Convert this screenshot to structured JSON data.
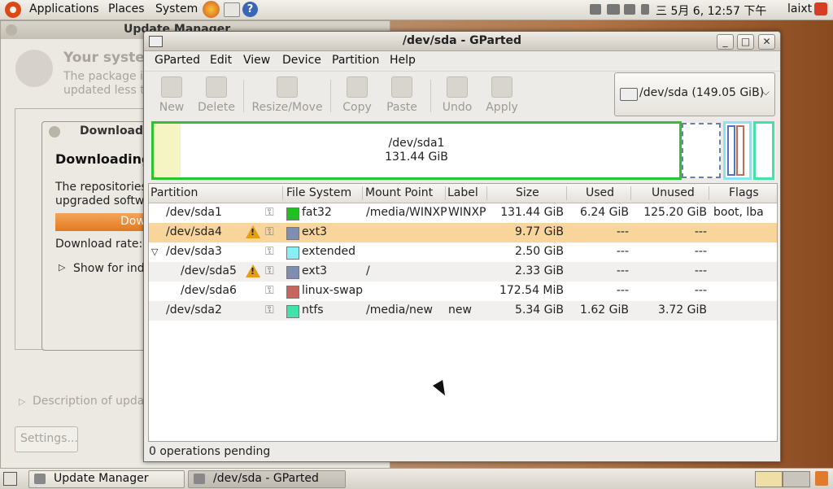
{
  "top_panel": {
    "applications": "Applications",
    "places": "Places",
    "system": "System",
    "clock": "三  5月   6, 12:57 下午",
    "user": "laixt"
  },
  "update_manager": {
    "title": "Update Manager",
    "heading": "Your syster",
    "subtext_1": "The package in",
    "subtext_2": "updated less th",
    "dialog_title": "Downloadi",
    "dialog_heading": "Downloading",
    "dialog_text_1": "The repositories",
    "dialog_text_2": "upgraded softwa",
    "dialog_button": "Dow",
    "download_rate": "Download rate: u",
    "show_for": "Show for indi",
    "description": "Description of update",
    "settings": "Settings..."
  },
  "gparted": {
    "title": "/dev/sda - GParted",
    "menu": {
      "gparted": "GParted",
      "edit": "Edit",
      "view": "View",
      "device": "Device",
      "partition": "Partition",
      "help": "Help"
    },
    "toolbar": {
      "new": "New",
      "delete": "Delete",
      "resize": "Resize/Move",
      "copy": "Copy",
      "paste": "Paste",
      "undo": "Undo",
      "apply": "Apply"
    },
    "device_selector": "/dev/sda  (149.05 GiB)",
    "map_sda1_name": "/dev/sda1",
    "map_sda1_size": "131.44 GiB",
    "columns": {
      "partition": "Partition",
      "filesystem": "File System",
      "mount": "Mount Point",
      "label": "Label",
      "size": "Size",
      "used": "Used",
      "unused": "Unused",
      "flags": "Flags"
    },
    "rows": [
      {
        "partition": "/dev/sda1",
        "fs": "fat32",
        "mount": "/media/WINXP",
        "label": "WINXP",
        "size": "131.44 GiB",
        "used": "6.24 GiB",
        "unused": "125.20 GiB",
        "flags": "boot, lba",
        "color": "#1ec21e"
      },
      {
        "partition": "/dev/sda4",
        "fs": "ext3",
        "mount": "",
        "label": "",
        "size": "9.77 GiB",
        "used": "---",
        "unused": "---",
        "flags": "",
        "color": "#7f8eb0"
      },
      {
        "partition": "/dev/sda3",
        "fs": "extended",
        "mount": "",
        "label": "",
        "size": "2.50 GiB",
        "used": "---",
        "unused": "---",
        "flags": "",
        "color": "#85f1f7"
      },
      {
        "partition": "/dev/sda5",
        "fs": "ext3",
        "mount": "/",
        "label": "",
        "size": "2.33 GiB",
        "used": "---",
        "unused": "---",
        "flags": "",
        "color": "#7f8eb0"
      },
      {
        "partition": "/dev/sda6",
        "fs": "linux-swap",
        "mount": "",
        "label": "",
        "size": "172.54 MiB",
        "used": "---",
        "unused": "---",
        "flags": "",
        "color": "#c5665c"
      },
      {
        "partition": "/dev/sda2",
        "fs": "ntfs",
        "mount": "/media/new",
        "label": "new",
        "size": "5.34 GiB",
        "used": "1.62 GiB",
        "unused": "3.72 GiB",
        "flags": "",
        "color": "#42e2ac"
      }
    ],
    "status": "0 operations pending"
  },
  "bottom_panel": {
    "task_update": "Update Manager",
    "task_gparted": "/dev/sda - GParted"
  }
}
